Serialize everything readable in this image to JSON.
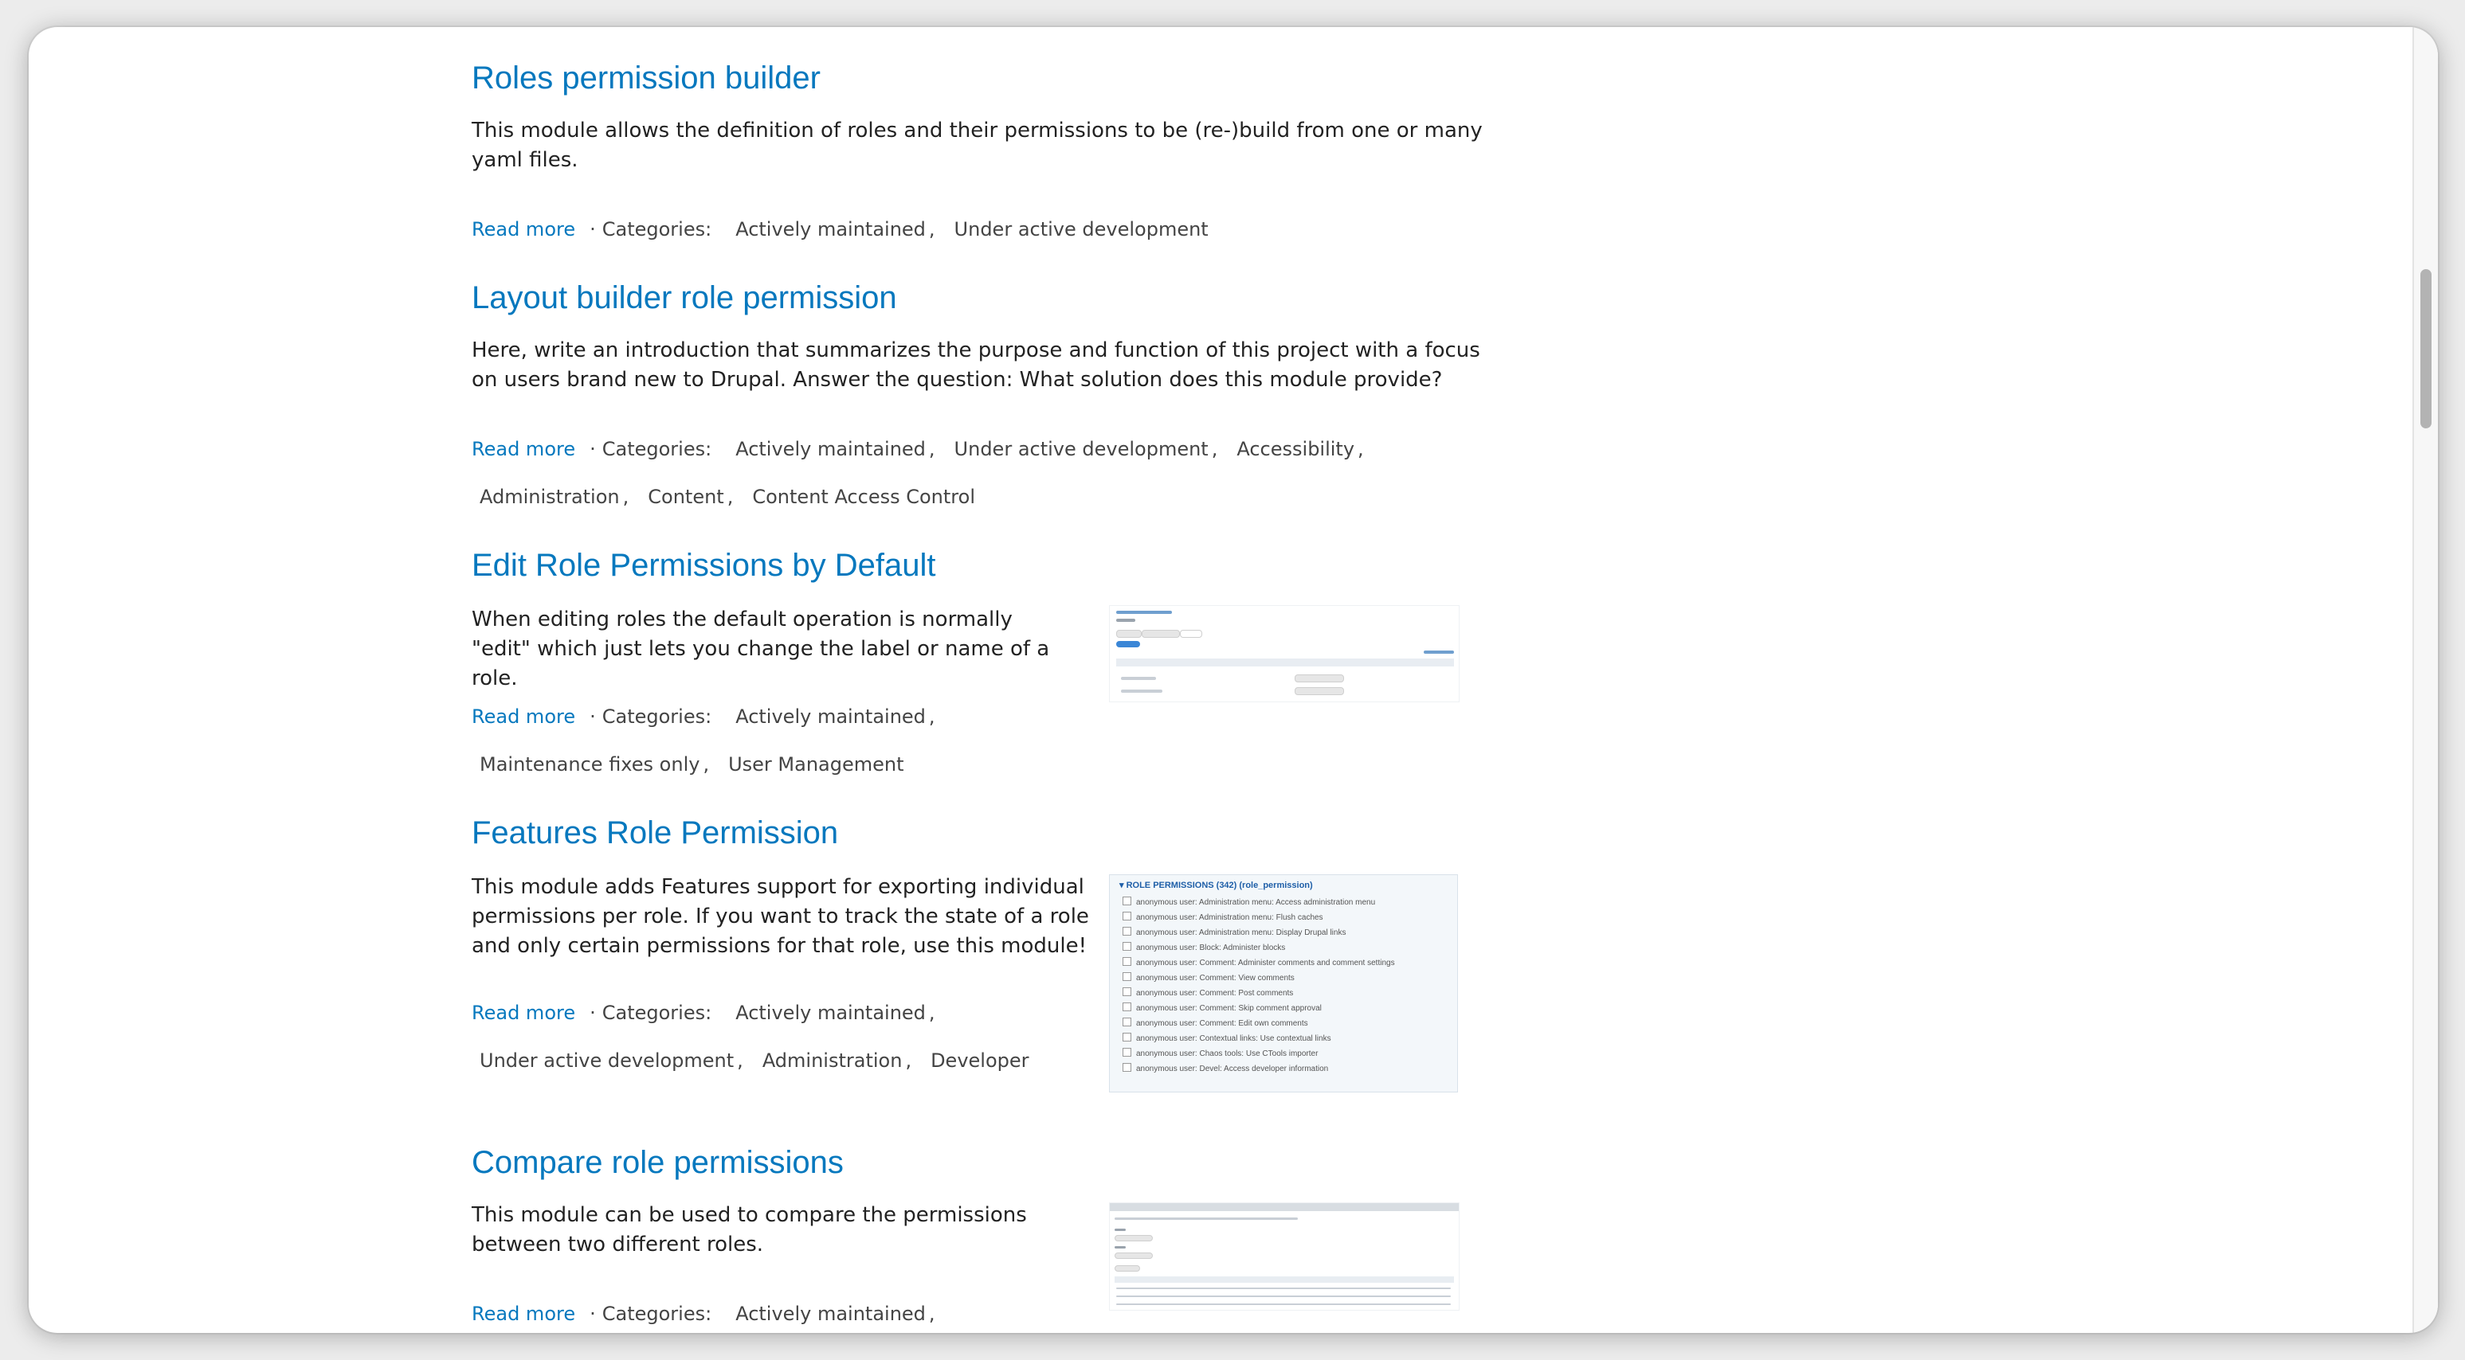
{
  "read_more_label": "Read more",
  "categories_label": "Categories:",
  "meta_separator": "·",
  "projects": [
    {
      "title": "Roles permission builder",
      "description": "This module allows the definition of roles and their permissions to be (re-)build from one or many yaml files.",
      "categories": [
        "Actively maintained",
        "Under active development"
      ]
    },
    {
      "title": "Layout builder role permission",
      "description": "Here, write an introduction that summarizes the purpose and function of this project with a focus on users brand new to Drupal. Answer the question: What solution does this module provide?",
      "categories": [
        "Actively maintained",
        "Under active development",
        "Accessibility",
        "Administration",
        "Content",
        "Content Access Control"
      ]
    },
    {
      "title": "Edit Role Permissions by Default",
      "description": "When editing roles the default operation is normally \"edit\" which just lets you change the label or name of a role.",
      "categories": [
        "Actively maintained",
        "Maintenance fixes only",
        "User Management"
      ]
    },
    {
      "title": "Features Role Permission",
      "description": "This module adds Features support for exporting individual permissions per role. If you want to track the state of a role and only certain permissions for that role, use this module!",
      "categories": [
        "Actively maintained",
        "Under active development",
        "Administration",
        "Developer"
      ]
    },
    {
      "title": "Compare role permissions",
      "description": "This module can be used to compare the permissions between two different roles.",
      "categories": [
        "Actively maintained"
      ]
    }
  ],
  "features_thumbnail": {
    "heading": "▾ ROLE PERMISSIONS (342) (role_permission)",
    "rows": [
      "anonymous user: Administration menu: Access administration menu",
      "anonymous user: Administration menu: Flush caches",
      "anonymous user: Administration menu: Display Drupal links",
      "anonymous user: Block: Administer blocks",
      "anonymous user: Comment: Administer comments and comment settings",
      "anonymous user: Comment: View comments",
      "anonymous user: Comment: Post comments",
      "anonymous user: Comment: Skip comment approval",
      "anonymous user: Comment: Edit own comments",
      "anonymous user: Contextual links: Use contextual links",
      "anonymous user: Chaos tools: Use CTools importer",
      "anonymous user: Devel: Access developer information"
    ]
  },
  "colors": {
    "link": "#0678be",
    "text": "#222222",
    "meta": "#444444"
  }
}
